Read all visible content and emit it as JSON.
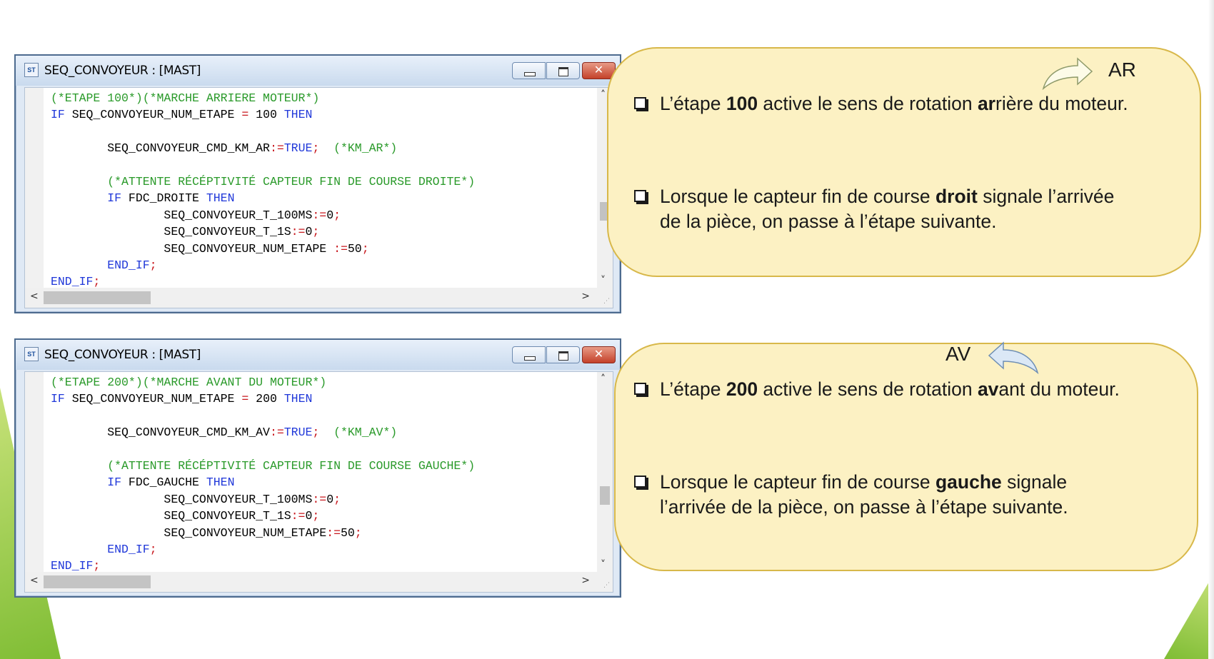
{
  "windows": [
    {
      "title": "SEQ_CONVOYEUR : [MAST]",
      "icon": "st-editor-icon",
      "code_lines": [
        [
          {
            "t": "comment",
            "v": "(*ETAPE 100*)(*MARCHE ARRIERE MOTEUR*)"
          }
        ],
        [
          {
            "t": "keyword",
            "v": "IF"
          },
          {
            "t": "ident",
            "v": " SEQ_CONVOYEUR_NUM_ETAPE "
          },
          {
            "t": "op",
            "v": "="
          },
          {
            "t": "number",
            "v": " 100 "
          },
          {
            "t": "keyword",
            "v": "THEN"
          }
        ],
        [],
        [
          {
            "t": "ident",
            "v": "        SEQ_CONVOYEUR_CMD_KM_AR"
          },
          {
            "t": "op",
            "v": ":="
          },
          {
            "t": "keyword",
            "v": "TRUE"
          },
          {
            "t": "op",
            "v": ";"
          },
          {
            "t": "comment",
            "v": "  (*KM_AR*)"
          }
        ],
        [],
        [
          {
            "t": "comment",
            "v": "        (*ATTENTE RÉCÉPTIVITÉ CAPTEUR FIN DE COURSE DROITE*)"
          }
        ],
        [
          {
            "t": "keyword",
            "v": "        IF"
          },
          {
            "t": "ident",
            "v": " FDC_DROITE "
          },
          {
            "t": "keyword",
            "v": "THEN"
          }
        ],
        [
          {
            "t": "ident",
            "v": "                SEQ_CONVOYEUR_T_100MS"
          },
          {
            "t": "op",
            "v": ":="
          },
          {
            "t": "number",
            "v": "0"
          },
          {
            "t": "op",
            "v": ";"
          }
        ],
        [
          {
            "t": "ident",
            "v": "                SEQ_CONVOYEUR_T_1S"
          },
          {
            "t": "op",
            "v": ":="
          },
          {
            "t": "number",
            "v": "0"
          },
          {
            "t": "op",
            "v": ";"
          }
        ],
        [
          {
            "t": "ident",
            "v": "                SEQ_CONVOYEUR_NUM_ETAPE "
          },
          {
            "t": "op",
            "v": ":="
          },
          {
            "t": "number",
            "v": "50"
          },
          {
            "t": "op",
            "v": ";"
          }
        ],
        [
          {
            "t": "keyword",
            "v": "        END_IF"
          },
          {
            "t": "op",
            "v": ";"
          }
        ],
        [
          {
            "t": "keyword",
            "v": "END_IF"
          },
          {
            "t": "op",
            "v": ";"
          }
        ]
      ]
    },
    {
      "title": "SEQ_CONVOYEUR : [MAST]",
      "icon": "st-editor-icon",
      "code_lines": [
        [
          {
            "t": "comment",
            "v": "(*ETAPE 200*)(*MARCHE AVANT DU MOTEUR*)"
          }
        ],
        [
          {
            "t": "keyword",
            "v": "IF"
          },
          {
            "t": "ident",
            "v": " SEQ_CONVOYEUR_NUM_ETAPE "
          },
          {
            "t": "op",
            "v": "="
          },
          {
            "t": "number",
            "v": " 200 "
          },
          {
            "t": "keyword",
            "v": "THEN"
          }
        ],
        [],
        [
          {
            "t": "ident",
            "v": "        SEQ_CONVOYEUR_CMD_KM_AV"
          },
          {
            "t": "op",
            "v": ":="
          },
          {
            "t": "keyword",
            "v": "TRUE"
          },
          {
            "t": "op",
            "v": ";"
          },
          {
            "t": "comment",
            "v": "  (*KM_AV*)"
          }
        ],
        [],
        [
          {
            "t": "comment",
            "v": "        (*ATTENTE RÉCÉPTIVITÉ CAPTEUR FIN DE COURSE GAUCHE*)"
          }
        ],
        [
          {
            "t": "keyword",
            "v": "        IF"
          },
          {
            "t": "ident",
            "v": " FDC_GAUCHE "
          },
          {
            "t": "keyword",
            "v": "THEN"
          }
        ],
        [
          {
            "t": "ident",
            "v": "                SEQ_CONVOYEUR_T_100MS"
          },
          {
            "t": "op",
            "v": ":="
          },
          {
            "t": "number",
            "v": "0"
          },
          {
            "t": "op",
            "v": ";"
          }
        ],
        [
          {
            "t": "ident",
            "v": "                SEQ_CONVOYEUR_T_1S"
          },
          {
            "t": "op",
            "v": ":="
          },
          {
            "t": "number",
            "v": "0"
          },
          {
            "t": "op",
            "v": ";"
          }
        ],
        [
          {
            "t": "ident",
            "v": "                SEQ_CONVOYEUR_NUM_ETAPE"
          },
          {
            "t": "op",
            "v": ":="
          },
          {
            "t": "number",
            "v": "50"
          },
          {
            "t": "op",
            "v": ";"
          }
        ],
        [
          {
            "t": "keyword",
            "v": "        END_IF"
          },
          {
            "t": "op",
            "v": ";"
          }
        ],
        [
          {
            "t": "keyword",
            "v": "END_IF"
          },
          {
            "t": "op",
            "v": ";"
          }
        ]
      ]
    }
  ],
  "callouts": [
    {
      "direction_label": "AR",
      "arrow_icon": "curved-arrow-right-icon",
      "bullets": [
        [
          {
            "b": false,
            "v": "L’étape "
          },
          {
            "b": true,
            "v": "100"
          },
          {
            "b": false,
            "v": " active le sens de rotation "
          },
          {
            "b": true,
            "v": "ar"
          },
          {
            "b": false,
            "v": "rière du moteur."
          }
        ],
        [
          {
            "b": false,
            "v": "Lorsque le capteur fin de course "
          },
          {
            "b": true,
            "v": "droit"
          },
          {
            "b": false,
            "v": " signale l’arrivée"
          },
          {
            "br": true
          },
          {
            "b": false,
            "v": "de la pièce, on passe à l’étape suivante."
          }
        ]
      ]
    },
    {
      "direction_label": "AV",
      "arrow_icon": "curved-arrow-left-icon",
      "bullets": [
        [
          {
            "b": false,
            "v": "L’étape "
          },
          {
            "b": true,
            "v": "200"
          },
          {
            "b": false,
            "v": " active le sens de rotation "
          },
          {
            "b": true,
            "v": "av"
          },
          {
            "b": false,
            "v": "ant du moteur."
          }
        ],
        [
          {
            "b": false,
            "v": "Lorsque le capteur fin de course "
          },
          {
            "b": true,
            "v": "gauche"
          },
          {
            "b": false,
            "v": " signale"
          },
          {
            "br": true
          },
          {
            "b": false,
            "v": "l’arrivée de la pièce, on passe à l’étape suivante."
          }
        ]
      ]
    }
  ],
  "colors": {
    "comment": "#2a9a2a",
    "keyword": "#1f37d9",
    "operator": "#c8181e",
    "callout_fill": "#fcf1c3",
    "callout_border": "#d8b84a",
    "deco_green": "#7fbd34"
  },
  "window_controls": {
    "minimize_icon": "minimize-icon",
    "maximize_icon": "maximize-icon",
    "close_icon": "close-icon",
    "close_glyph": "✕"
  },
  "scrollbars": {
    "up": "˄",
    "down": "˅",
    "left": "<",
    "right": ">",
    "grip": "⋰"
  },
  "icon_glyph": "ST"
}
